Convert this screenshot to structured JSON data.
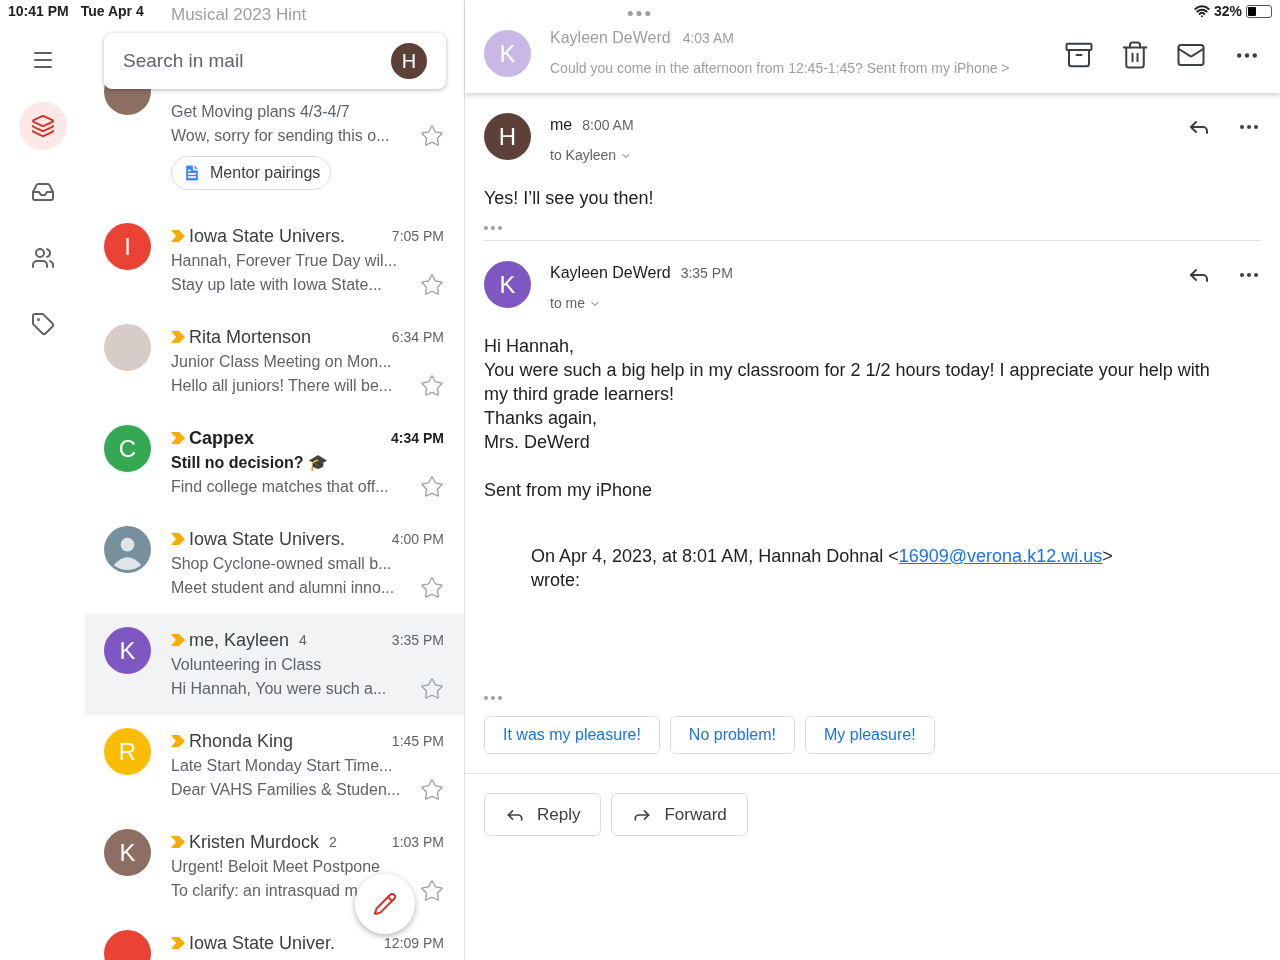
{
  "status_bar": {
    "time": "10:41 PM",
    "date": "Tue Apr 4",
    "battery": "32%"
  },
  "rail": [
    {
      "kind": "inbox_stack",
      "selected": true
    },
    {
      "kind": "inbox",
      "selected": false
    },
    {
      "kind": "people",
      "selected": false
    },
    {
      "kind": "label",
      "selected": false
    }
  ],
  "search": {
    "placeholder": "Search in mail",
    "account_initial": "H"
  },
  "faded_row": {
    "subject": "Musical 2023 Hint"
  },
  "first_row": {
    "subject": "Get Moving plans 4/3-4/7",
    "snippet": "Wow, sorry for sending this o...",
    "attachment": "Mentor pairings"
  },
  "emails": [
    {
      "kind": "letter",
      "initial": "I",
      "color": "#ea4335",
      "sender": "Iowa State Univers.",
      "time": "7:05 PM",
      "subject": "Hannah, Forever True Day wil...",
      "snippet": "Stay up late with Iowa State...",
      "unread": false,
      "selected": false,
      "important": true
    },
    {
      "kind": "photo",
      "sender": "Rita Mortenson",
      "time": "6:34 PM",
      "subject": "Junior Class Meeting on Mon...",
      "snippet": "Hello all juniors! There will be...",
      "unread": false,
      "selected": false,
      "important": true
    },
    {
      "kind": "letter",
      "initial": "C",
      "color": "#34a853",
      "sender": "Cappex",
      "time": "4:34 PM",
      "subject": "Still no decision? 🎓",
      "snippet": "Find college matches that off...",
      "unread": true,
      "selected": false,
      "important": true
    },
    {
      "kind": "silhouette",
      "color": "#78909c",
      "sender": "Iowa State Univers.",
      "time": "4:00 PM",
      "subject": "Shop Cyclone-owned small b...",
      "snippet": "Meet student and alumni inno...",
      "unread": false,
      "selected": false,
      "important": true
    },
    {
      "kind": "letter",
      "initial": "K",
      "color": "#7e57c2",
      "sender": "me, Kayleen",
      "count": "4",
      "time": "3:35 PM",
      "subject": "Volunteering in Class",
      "snippet": "Hi Hannah, You were such a...",
      "unread": false,
      "selected": true,
      "important": true
    },
    {
      "kind": "letter",
      "initial": "R",
      "color": "#fbbc04",
      "sender": "Rhonda King",
      "time": "1:45 PM",
      "subject": "Late Start Monday Start Time...",
      "snippet": "Dear VAHS Families & Studen...",
      "unread": false,
      "selected": false,
      "important": true
    },
    {
      "kind": "letter",
      "initial": "K",
      "color": "#8d6e63",
      "sender": "Kristen Murdock",
      "count": "2",
      "time": "1:03 PM",
      "subject": "Urgent! Beloit Meet Postpone",
      "snippet": "To clarify: an intrasquad m",
      "unread": false,
      "selected": false,
      "important": true
    },
    {
      "kind": "letter",
      "color": "#ea4335",
      "sender": "Iowa State Univer.",
      "time": "12:09 PM",
      "unread": false,
      "selected": false,
      "important": true
    }
  ],
  "collapsed_message": {
    "initial": "K",
    "sender": "Kayleen DeWerd",
    "time": "4:03 AM",
    "snippet": "Could you come in the afternoon from 12:45-1:45? Sent from my iPhone >"
  },
  "messages": [
    {
      "initial": "H",
      "color": "#5d4037",
      "sender": "me",
      "time": "8:00 AM",
      "recipient": "to Kayleen",
      "body": [
        "Yes! I’ll see you then!"
      ]
    },
    {
      "initial": "K",
      "color": "#7e57c2",
      "sender": "Kayleen DeWerd",
      "time": "3:35 PM",
      "recipient": "to me",
      "body": [
        "Hi Hannah,",
        "You were such a big help in my classroom for 2 1/2 hours today! I appreciate your help with my third grade learners!",
        "Thanks again,",
        "Mrs. DeWerd"
      ],
      "signature": "Sent from my iPhone",
      "quote": {
        "before": "On Apr 4, 2023, at 8:01 AM, Hannah Dohnal <",
        "link": "16909@verona.k12.wi.us",
        "after": ">",
        "line2": "wrote:"
      }
    }
  ],
  "smart_replies": [
    "It was my pleasure!",
    "No problem!",
    "My pleasure!"
  ],
  "actions": [
    {
      "kind": "reply",
      "label": "Reply"
    },
    {
      "kind": "forward",
      "label": "Forward"
    }
  ]
}
